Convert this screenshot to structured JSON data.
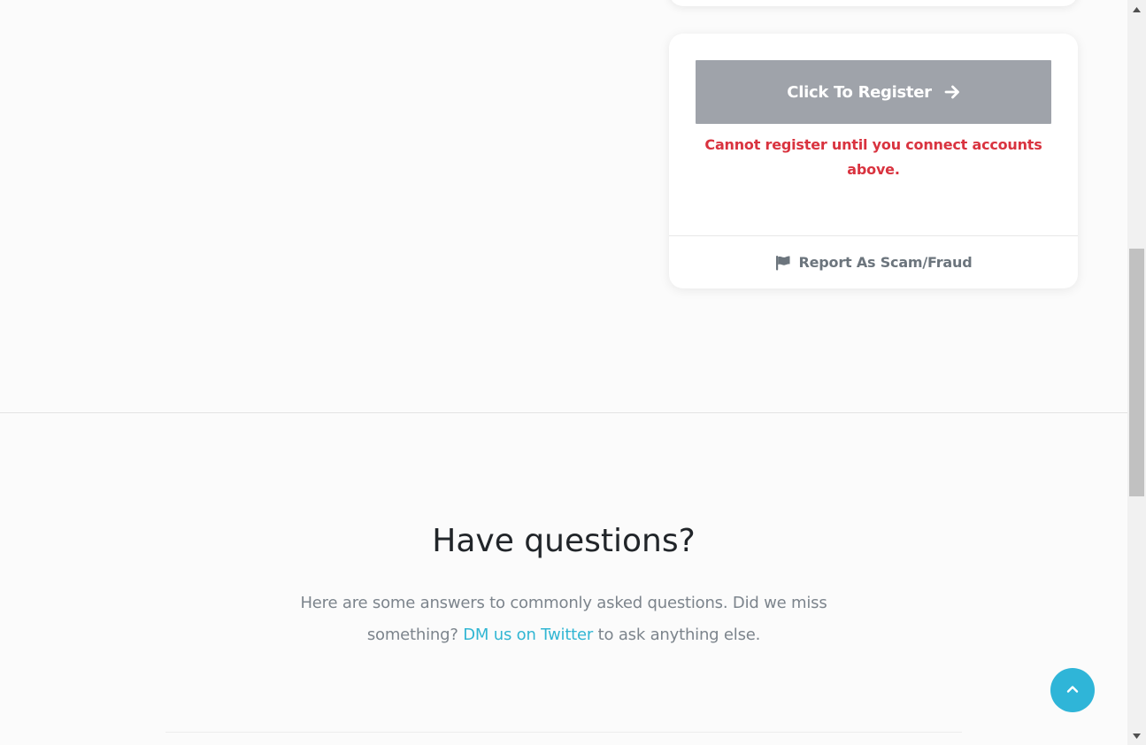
{
  "register_card": {
    "button_label": "Click To Register",
    "button_icon": "arrow-right-icon",
    "error_message": "Cannot register until you connect accounts above.",
    "report_label": "Report As Scam/Fraud",
    "report_icon": "flag-icon"
  },
  "faq": {
    "title": "Have questions?",
    "subtitle_before": "Here are some answers to commonly asked questions. Did we miss something?",
    "subtitle_link": "DM us on Twitter",
    "subtitle_after": "to ask anything else."
  },
  "back_to_top": {
    "icon": "chevron-up-icon"
  },
  "colors": {
    "button_disabled": "#9fa3aa",
    "error": "#d9333f",
    "link": "#31b6d3",
    "back_to_top": "#2fb5d8"
  }
}
